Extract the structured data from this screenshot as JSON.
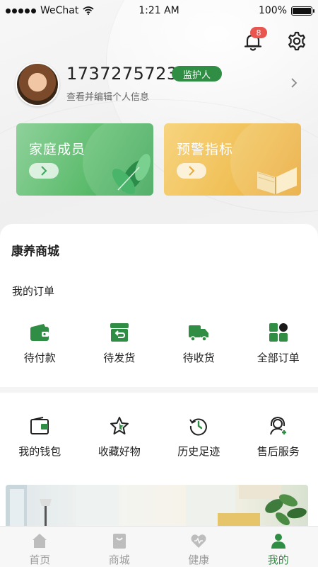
{
  "status_bar": {
    "carrier": "WeChat",
    "time": "1:21 AM",
    "battery": "100%",
    "battery_level": 1.0
  },
  "header": {
    "notification_count": "8"
  },
  "profile": {
    "phone": "1737275723",
    "role_tag": "监护人",
    "edit_hint": "查看并编辑个人信息"
  },
  "cards": {
    "family": "家庭成员",
    "warning": "预警指标"
  },
  "mall": {
    "title": "康养商城",
    "orders_title": "我的订单",
    "orders": [
      {
        "label": "待付款",
        "icon": "wallet-icon"
      },
      {
        "label": "待发货",
        "icon": "box-return-icon"
      },
      {
        "label": "待收货",
        "icon": "truck-icon"
      },
      {
        "label": "全部订单",
        "icon": "grid-icon"
      }
    ],
    "services": [
      {
        "label": "我的钱包",
        "icon": "wallet-outline-icon"
      },
      {
        "label": "收藏好物",
        "icon": "star-icon"
      },
      {
        "label": "历史足迹",
        "icon": "history-icon"
      },
      {
        "label": "售后服务",
        "icon": "support-agent-icon"
      }
    ]
  },
  "tabbar": {
    "tabs": [
      {
        "label": "首页",
        "icon": "home-icon"
      },
      {
        "label": "商城",
        "icon": "shopping-bag-icon"
      },
      {
        "label": "健康",
        "icon": "heart-icon"
      },
      {
        "label": "我的",
        "icon": "person-icon"
      }
    ],
    "active_index": 3
  },
  "colors": {
    "brand_green": "#2f8e43",
    "badge_red": "#e8564f",
    "inactive_gray": "#9b9b9b"
  }
}
